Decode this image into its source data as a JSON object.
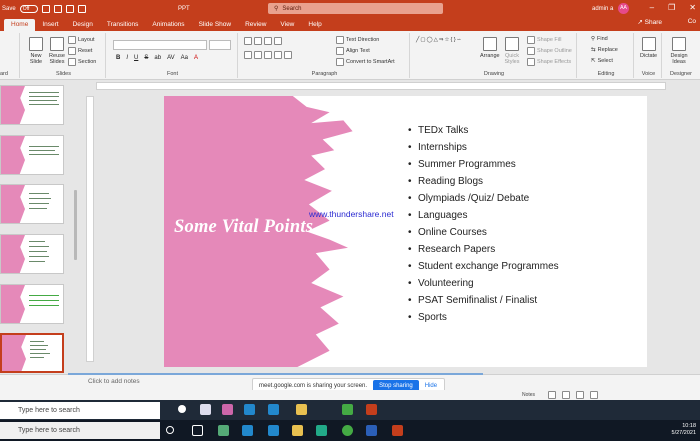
{
  "titlebar": {
    "autosave_label": "Save",
    "autosave_state": "Off",
    "doc_title": "PPT",
    "search_placeholder": "Search",
    "user_name": "admin a",
    "user_initials": "AA"
  },
  "tabs": [
    "Home",
    "Insert",
    "Design",
    "Transitions",
    "Animations",
    "Slide Show",
    "Review",
    "View",
    "Help"
  ],
  "active_tab": "Home",
  "share_label": "Share",
  "comments_label": "Co",
  "ribbon": {
    "slides": {
      "new_slide": "New Slide",
      "reuse_slides": "Reuse Slides",
      "layout": "Layout",
      "reset": "Reset",
      "section": "Section",
      "label": "Slides"
    },
    "font": {
      "bold": "B",
      "italic": "I",
      "underline": "U",
      "strike": "S",
      "label": "Font"
    },
    "paragraph": {
      "text_direction": "Text Direction",
      "align_text": "Align Text",
      "convert": "Convert to SmartArt",
      "label": "Paragraph"
    },
    "drawing": {
      "arrange": "Arrange",
      "quick_styles": "Quick Styles",
      "shape_fill": "Shape Fill",
      "shape_outline": "Shape Outline",
      "shape_effects": "Shape Effects",
      "label": "Drawing"
    },
    "editing": {
      "find": "Find",
      "replace": "Replace",
      "select": "Select",
      "label": "Editing"
    },
    "voice": {
      "dictate": "Dictate",
      "label": "Voice"
    },
    "designer": {
      "design_ideas": "Design Ideas",
      "label": "Designer"
    }
  },
  "slide": {
    "title": "Some Vital Points",
    "watermark": "www.thundershare.net",
    "bullets": [
      "TEDx Talks",
      "Internships",
      "Summer Programmes",
      "Reading Blogs",
      "Olympiads /Quiz/ Debate",
      "Languages",
      "Online Courses",
      "Research Papers",
      "Student exchange Programmes",
      "Volunteering",
      "PSAT Semifinalist / Finalist",
      "Sports"
    ]
  },
  "notes_placeholder": "Click to add notes",
  "screen_share": {
    "message": "meet.google.com is sharing your screen.",
    "stop_label": "Stop sharing",
    "hide_label": "Hide"
  },
  "statusbar": {
    "notes": "Notes"
  },
  "taskbar": {
    "search_text_1": "Type here to search",
    "search_text_2": "Type here to search",
    "time": "10:18",
    "date": "5/27/2021"
  },
  "colors": {
    "accent": "#c43e1c",
    "slide_pink": "#e589b9",
    "watermark": "#2b2bd1"
  }
}
